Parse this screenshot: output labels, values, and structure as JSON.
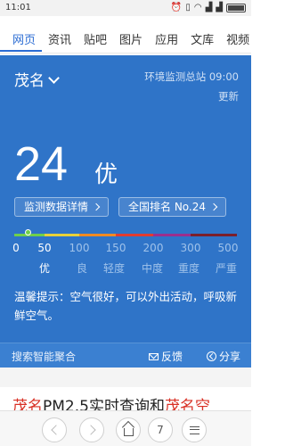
{
  "status_bar": {
    "time": "11:01",
    "icons": [
      "alarm-icon",
      "vibrate-icon",
      "wifi-icon",
      "signal-icon",
      "signal-icon",
      "battery-icon"
    ]
  },
  "tabs": [
    {
      "label": "网页",
      "active": true
    },
    {
      "label": "资讯",
      "active": false
    },
    {
      "label": "贴吧",
      "active": false
    },
    {
      "label": "图片",
      "active": false
    },
    {
      "label": "应用",
      "active": false
    },
    {
      "label": "文库",
      "active": false
    },
    {
      "label": "视频",
      "active": false
    }
  ],
  "aqi_card": {
    "city": "茂名",
    "station_time": "环境监测总站 09:00",
    "updated": "更新",
    "aqi_value": "24",
    "aqi_level": "优",
    "details_button": "监测数据详情",
    "rank_button": "全国排名 No.24",
    "scale_ticks": [
      "0",
      "50",
      "100",
      "150",
      "200",
      "300",
      "500"
    ],
    "scale_levels": [
      "优",
      "良",
      "轻度",
      "中度",
      "重度",
      "严重"
    ],
    "scale_colors": [
      "#6fcf4b",
      "#e8d13a",
      "#f08a24",
      "#e03c31",
      "#9b2f8e",
      "#7a1f2b"
    ],
    "current_index": 0,
    "tip": "温馨提示：空气很好，可以外出活动，呼吸新鲜空气。",
    "footer_label": "搜索智能聚合",
    "feedback_label": "反馈",
    "share_label": "分享"
  },
  "result": {
    "hl1": "茂名",
    "mid": "PM2.5实时查询和",
    "hl2": "茂名空"
  },
  "bottom_nav": {
    "tab_count": "7"
  },
  "colors": {
    "accent": "#2b6cd3",
    "card_bg": "#2f74c8",
    "highlight": "#d93025"
  }
}
